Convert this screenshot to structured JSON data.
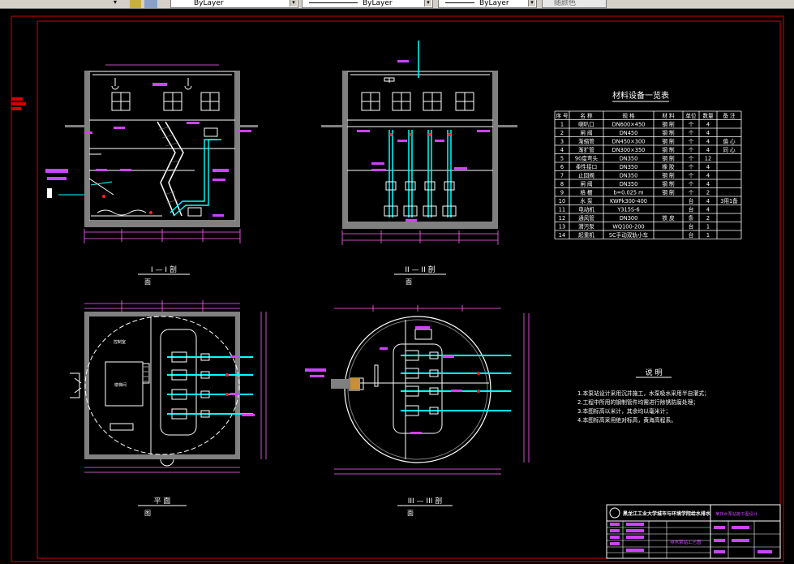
{
  "toolbar": {
    "layer_label": "ByLayer",
    "linetype_label": "ByLayer",
    "lineweight_label": "ByLayer",
    "color_label": "随颜色"
  },
  "views": {
    "sec1": {
      "title": "I — I 剖",
      "sub": "面"
    },
    "sec2": {
      "title": "II — II 剖",
      "sub": "面"
    },
    "plan": {
      "title": "平   面",
      "sub": "图"
    },
    "sec3": {
      "title": "III — III 剖",
      "sub": "面"
    }
  },
  "plan_labels": {
    "control_room": "控制室",
    "stairs": "楼梯间"
  },
  "table": {
    "title": "材料设备一览表",
    "headers": [
      "序 号",
      "名   称",
      "规      格",
      "材 料",
      "单位",
      "数量",
      "备 注"
    ],
    "rows": [
      [
        "1",
        "喇叭口",
        "DN600×450",
        "钢 制",
        "个",
        "4",
        ""
      ],
      [
        "2",
        "闸 阀",
        "DN450",
        "钢 制",
        "个",
        "4",
        ""
      ],
      [
        "3",
        "渐缩管",
        "DN450×300",
        "钢 制",
        "个",
        "4",
        "偏 心"
      ],
      [
        "4",
        "渐扩管",
        "DN300×350",
        "钢 制",
        "个",
        "4",
        "同 心"
      ],
      [
        "5",
        "90度弯头",
        "DN350",
        "钢 制",
        "个",
        "12",
        ""
      ],
      [
        "6",
        "柔性接口",
        "DN350",
        "橡 胶",
        "个",
        "4",
        ""
      ],
      [
        "7",
        "止回阀",
        "DN350",
        "钢 制",
        "个",
        "4",
        ""
      ],
      [
        "8",
        "闸 阀",
        "DN350",
        "钢 制",
        "个",
        "4",
        ""
      ],
      [
        "9",
        "格 栅",
        "b=0.025 m",
        "钢 制",
        "个",
        "2",
        ""
      ],
      [
        "10",
        "水 泵",
        "KWPk300-400",
        "",
        "台",
        "4",
        "3用1备"
      ],
      [
        "11",
        "电动机",
        "Y315S-6",
        "",
        "台",
        "4",
        ""
      ],
      [
        "12",
        "通风管",
        "DN300",
        "铁 皮",
        "条",
        "2",
        ""
      ],
      [
        "13",
        "潜污泵",
        "WQ100-200",
        "",
        "台",
        "1",
        ""
      ],
      [
        "14",
        "起重机",
        "SC手动双轨小车",
        "",
        "台",
        "1",
        ""
      ]
    ]
  },
  "notes": {
    "title": "说    明",
    "items": [
      "1.本泵站设计采用沉井施工，水泵吸水采用半自灌式；",
      "2.工程中所用的钢制管件均需进行除锈防腐处理；",
      "3.本图标高以米计，其余均以毫米计；",
      "4.本图标高采用绝对标高，黄海高程系。"
    ]
  },
  "title_block": {
    "school": "黑龙江工业大学城市与环境学院给水排水",
    "project": "某排水泵站施工图设计",
    "drawing": "排水泵站工艺图"
  },
  "colors": {
    "background": "#000000",
    "frame": "#d40000",
    "lines": "#ffffff",
    "dims": "#ff66ff",
    "labels": "#cc44ff",
    "pipe": "#00ffff",
    "hatch": "#808080",
    "alert": "#ff2020"
  }
}
